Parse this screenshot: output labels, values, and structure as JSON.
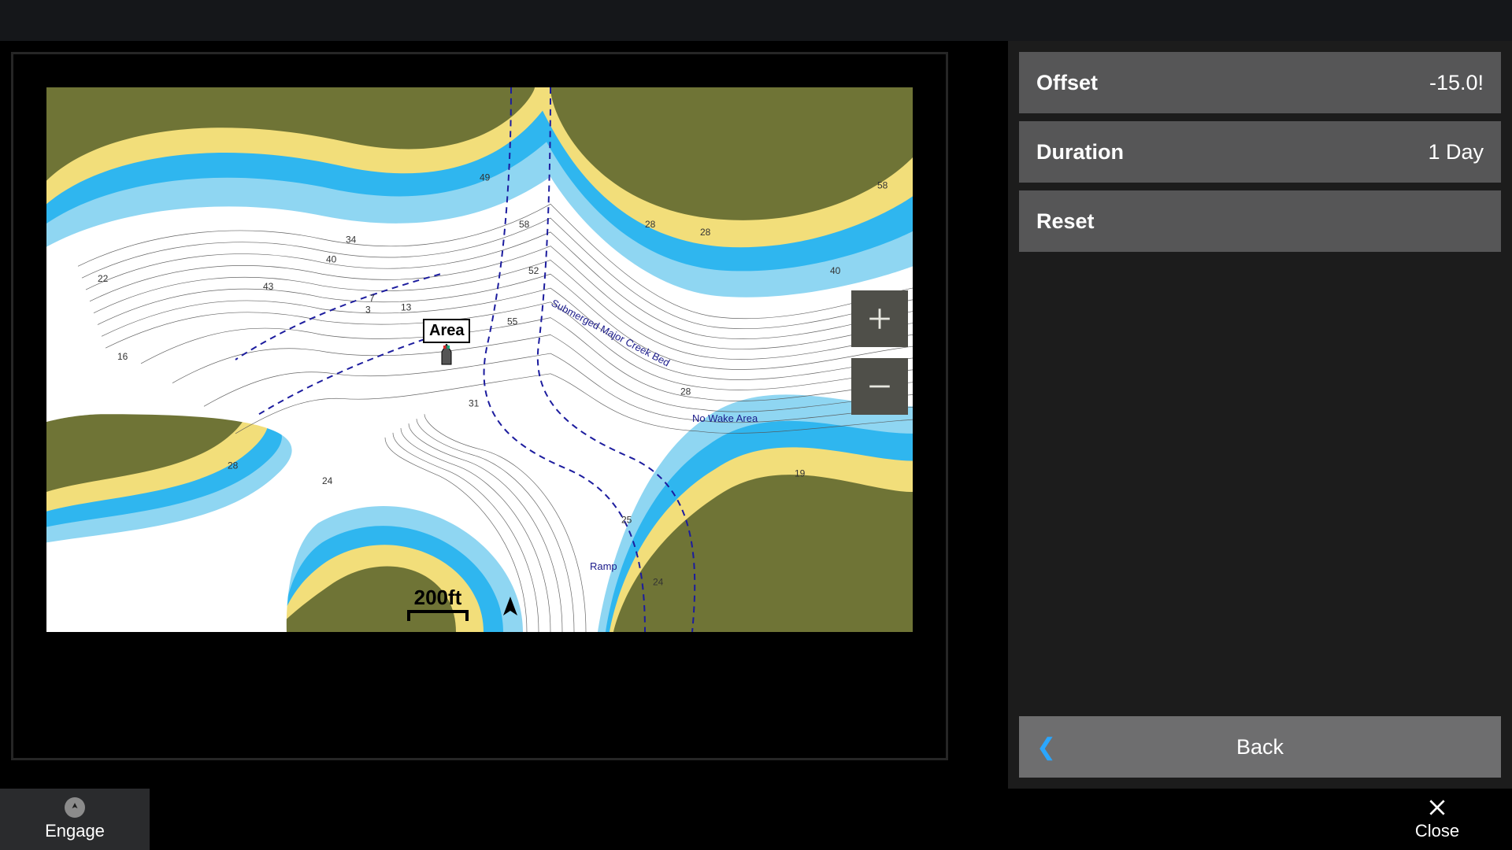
{
  "side": {
    "offset": {
      "label": "Offset",
      "value": "-15.0!"
    },
    "duration": {
      "label": "Duration",
      "value": "1 Day"
    },
    "reset": {
      "label": "Reset"
    },
    "back": {
      "label": "Back"
    }
  },
  "bottom": {
    "engage": "Engage",
    "close": "Close"
  },
  "map": {
    "area_label": "Area",
    "scale": "200ft",
    "labels": {
      "creek": "Submerged Major Creek Bed",
      "nowake": "No Wake Area",
      "ramp": "Ramp"
    },
    "depths": [
      "3",
      "7",
      "13",
      "16",
      "19",
      "22",
      "24",
      "25",
      "28",
      "28",
      "31",
      "34",
      "40",
      "40",
      "43",
      "49",
      "52",
      "55",
      "58",
      "58"
    ]
  }
}
